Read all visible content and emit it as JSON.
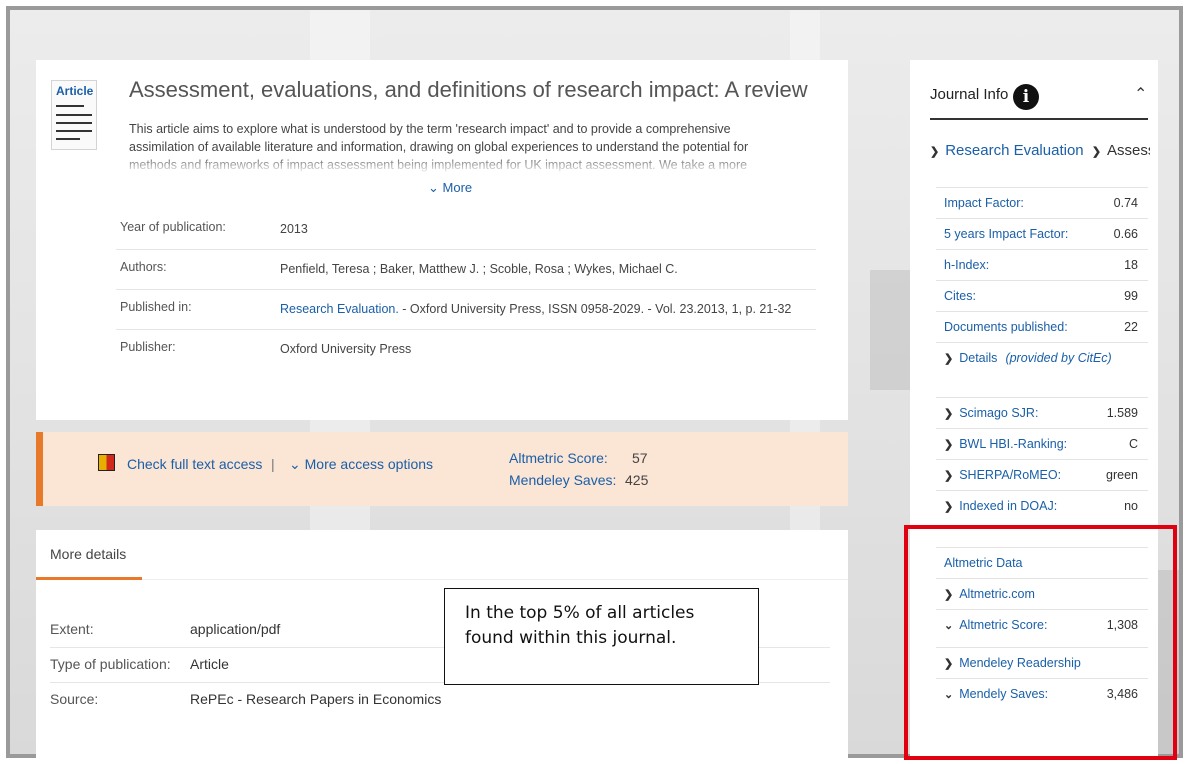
{
  "article": {
    "type_label": "Article",
    "title": "Assessment, evaluations, and definitions of research impact: A review",
    "abstract": "This article aims to explore what is understood by the term 'research impact' and to provide a comprehensive assimilation of available literature and information, drawing on global experiences to understand the potential for methods and frameworks of impact assessment being implemented for UK impact assessment. We take a more focused",
    "more_label": "More",
    "meta": {
      "year_label": "Year of publication:",
      "year": "2013",
      "authors_label": "Authors:",
      "authors": "Penfield, Teresa ; Baker, Matthew J. ; Scoble, Rosa ; Wykes, Michael C.",
      "published_label": "Published in:",
      "published_link": "Research Evaluation.",
      "published_rest": " - Oxford University Press, ISSN 0958-2029. - Vol. 23.2013, 1, p. 21-32",
      "publisher_label": "Publisher:",
      "publisher": "Oxford University Press"
    }
  },
  "access": {
    "check_label": "Check full text access",
    "separator": "|",
    "more_label": "More access options",
    "altmetric_label": "Altmetric Score:",
    "altmetric_value": "57",
    "mendeley_label": "Mendeley Saves:",
    "mendeley_value": "425"
  },
  "details": {
    "tab_label": "More details",
    "extent_label": "Extent:",
    "extent": "application/pdf",
    "type_label": "Type of publication:",
    "type": "Article",
    "source_label": "Source:",
    "source": "RePEc - Research Papers in Economics"
  },
  "callout": {
    "line1": "In the top 5% of all articles",
    "line2": "found within this journal."
  },
  "sidebar": {
    "title": "Journal Info",
    "info_glyph": "i",
    "collapse_glyph": "^",
    "breadcrumb_journal": "Research Evaluation",
    "breadcrumb_current": "Assess...",
    "metrics": [
      {
        "label": "Impact Factor:",
        "value": "0.74"
      },
      {
        "label": "5 years Impact Factor:",
        "value": "0.66"
      },
      {
        "label": "h-Index:",
        "value": "18"
      },
      {
        "label": "Cites:",
        "value": "99"
      },
      {
        "label": "Documents published:",
        "value": "22"
      }
    ],
    "details_label": "Details",
    "details_note": "(provided by CitEc)",
    "rankings": [
      {
        "label": "Scimago SJR:",
        "value": "1.589"
      },
      {
        "label": "BWL HBI.-Ranking:",
        "value": "C"
      },
      {
        "label": "SHERPA/RoMEO:",
        "value": "green"
      },
      {
        "label": "Indexed in DOAJ:",
        "value": "no"
      }
    ],
    "altmetric_section": "Altmetric Data",
    "altmetric_com": "Altmetric.com",
    "altmetric_score_label": "Altmetric Score:",
    "altmetric_score_value": "1,308",
    "mendeley_readership": "Mendeley Readership",
    "mendeley_saves_label": "Mendely Saves:",
    "mendeley_saves_value": "3,486"
  },
  "colors": {
    "accent_orange": "#e8782a",
    "link_blue": "#1a5fa8",
    "highlight_red": "#e0000f"
  }
}
